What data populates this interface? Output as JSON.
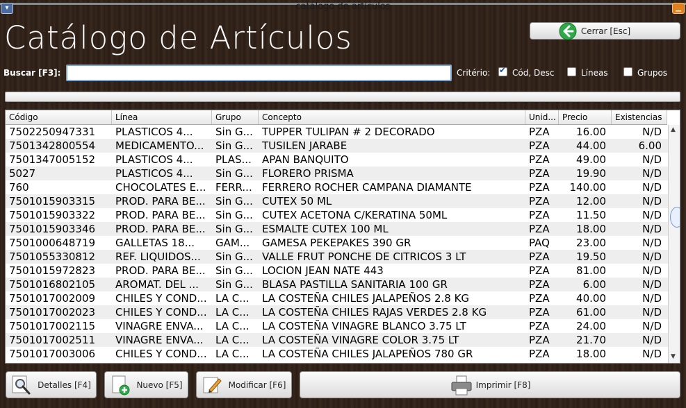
{
  "window": {
    "title": "catálogo de artículos"
  },
  "heading": "Catálogo de Artículos",
  "buttons": {
    "close": "Cerrar [Esc]",
    "details": "Detalles [F4]",
    "new": "Nuevo [F5]",
    "edit": "Modificar [F6]",
    "print": "Imprimir [F8]"
  },
  "search": {
    "label": "Buscar [F3]:",
    "value": ""
  },
  "criteria": {
    "label": "Critério:",
    "options": [
      {
        "label": "Cód, Desc",
        "checked": true
      },
      {
        "label": "Líneas",
        "checked": false
      },
      {
        "label": "Grupos",
        "checked": false
      }
    ]
  },
  "table": {
    "columns": [
      "Código",
      "Línea",
      "Grupo",
      "Concepto",
      "Unid...",
      "Precio",
      "Existencias"
    ],
    "rows": [
      [
        "7502250947331",
        "PLASTICOS     4...",
        "Sin G...",
        "TUPPER TULIPAN # 2 DECORADO",
        "PZA",
        "16.00",
        "N/D"
      ],
      [
        "7501342800554",
        "MEDICAMENTO...",
        "Sin G...",
        "TUSILEN JARABE",
        "PZA",
        "44.00",
        "6.00"
      ],
      [
        "7501347005152",
        "PLASTICOS     4...",
        "PLAS...",
        "APAN BANQUITO",
        "PZA",
        "49.00",
        "N/D"
      ],
      [
        "5027",
        "PLASTICOS     4...",
        "Sin G...",
        "FLORERO PRISMA",
        "PZA",
        "19.90",
        "N/D"
      ],
      [
        "760",
        "CHOCOLATES E...",
        "FERR...",
        "FERRERO ROCHER CAMPANA DIAMANTE",
        "PZA",
        "140.00",
        "N/D"
      ],
      [
        "7501015903315",
        "PROD. PARA BE...",
        "Sin G...",
        "CUTEX 50 ML",
        "PZA",
        "12.00",
        "N/D"
      ],
      [
        "7501015903322",
        "PROD. PARA BE...",
        "Sin G...",
        "CUTEX ACETONA C/KERATINA 50ML",
        "PZA",
        "11.50",
        "N/D"
      ],
      [
        "7501015903346",
        "PROD. PARA BE...",
        "Sin G...",
        "ESMALTE CUTEX 100 ML",
        "PZA",
        "18.00",
        "N/D"
      ],
      [
        "7501000648719",
        "GALLETAS     18...",
        "GAM...",
        "GAMESA PEKEPAKES 390 GR",
        "PAQ",
        "23.00",
        "N/D"
      ],
      [
        "7501055330812",
        "REF. LIQUIDOS...",
        "Sin G...",
        "VALLE FRUT PONCHE DE CITRICOS 3 LT",
        "PZA",
        "19.50",
        "N/D"
      ],
      [
        "7501015972823",
        "PROD. PARA BE...",
        "Sin G...",
        "LOCION JEAN NATE 443",
        "PZA",
        "81.00",
        "N/D"
      ],
      [
        "7501016802105",
        "AROMAT. DEL ...",
        "Sin G...",
        "BLASA PASTILLA SANITARIA 100 GR",
        "PZA",
        "6.00",
        "N/D"
      ],
      [
        "7501017002009",
        "CHILES Y COND...",
        "LA C...",
        "LA COSTEÑA CHILES JALAPEÑOS 2.8 KG",
        "PZA",
        "40.00",
        "N/D"
      ],
      [
        "7501017002023",
        "CHILES Y COND...",
        "LA C...",
        "LA COSTEÑA CHILES RAJAS VERDES 2.8 KG",
        "PZA",
        "61.00",
        "N/D"
      ],
      [
        "7501017002115",
        "VINAGRE ENVA...",
        "LA C...",
        "LA COSTEÑA VINAGRE BLANCO 3.75 LT",
        "PZA",
        "24.00",
        "N/D"
      ],
      [
        "7501017002511",
        "VINAGRE ENVA...",
        "LA C...",
        "LA COSTEÑA VINAGRE COLOR 3.75 LT",
        "PZA",
        "21.70",
        "N/D"
      ],
      [
        "7501017003006",
        "CHILES Y COND...",
        "LA C...",
        "LA COSTEÑA CHILES JALAPEÑOS 780 GR",
        "PZA",
        "18.00",
        "N/D"
      ]
    ]
  },
  "icons": {
    "close": "back-arrow-icon",
    "details": "magnifier-icon",
    "new": "new-document-icon",
    "edit": "pencil-icon",
    "print": "printer-icon"
  },
  "colors": {
    "accent": "#2fa84a",
    "focus": "#7aa7d8"
  }
}
